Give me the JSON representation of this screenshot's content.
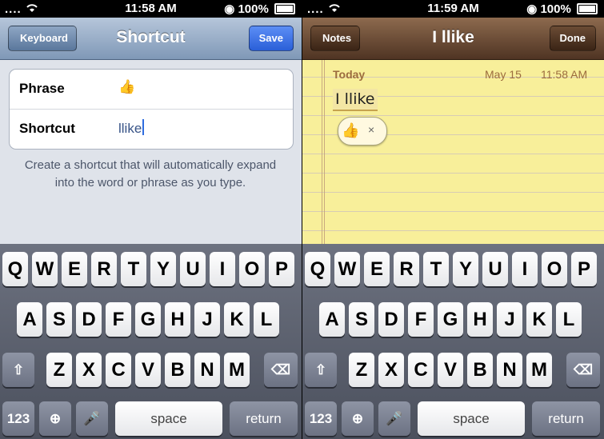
{
  "left": {
    "status": {
      "carrier": "....",
      "time": "11:58 AM",
      "battery": "100%"
    },
    "nav": {
      "back": "Keyboard",
      "title": "Shortcut",
      "action": "Save"
    },
    "form": {
      "phrase_label": "Phrase",
      "phrase_value": "👍",
      "shortcut_label": "Shortcut",
      "shortcut_value": "llike"
    },
    "help": "Create a shortcut that will automatically expand into the word or phrase as you type.",
    "keyboard": {
      "space": "space",
      "return": "return",
      "numbers": "123"
    }
  },
  "right": {
    "status": {
      "carrier": "....",
      "time": "11:59 AM",
      "battery": "100%"
    },
    "nav": {
      "back": "Notes",
      "title": "I llike",
      "action": "Done"
    },
    "note": {
      "today": "Today",
      "date": "May 15",
      "time": "11:58 AM",
      "text": "I llike",
      "suggestion": "👍",
      "dismiss": "×"
    },
    "keyboard": {
      "space": "space",
      "return": "return",
      "numbers": "123"
    }
  },
  "keys": {
    "row1": [
      "Q",
      "W",
      "E",
      "R",
      "T",
      "Y",
      "U",
      "I",
      "O",
      "P"
    ],
    "row2": [
      "A",
      "S",
      "D",
      "F",
      "G",
      "H",
      "J",
      "K",
      "L"
    ],
    "row3": [
      "Z",
      "X",
      "C",
      "V",
      "B",
      "N",
      "M"
    ]
  },
  "icons": [
    "wifi-icon",
    "apple-icon",
    "lock-icon",
    "battery-icon",
    "shift-icon",
    "delete-icon",
    "globe-icon",
    "microphone-icon"
  ],
  "colors": {
    "notes_paper": "#f8ef9a",
    "save_blue": "#2a5fd8",
    "settings_nav": "#7f98b7"
  }
}
